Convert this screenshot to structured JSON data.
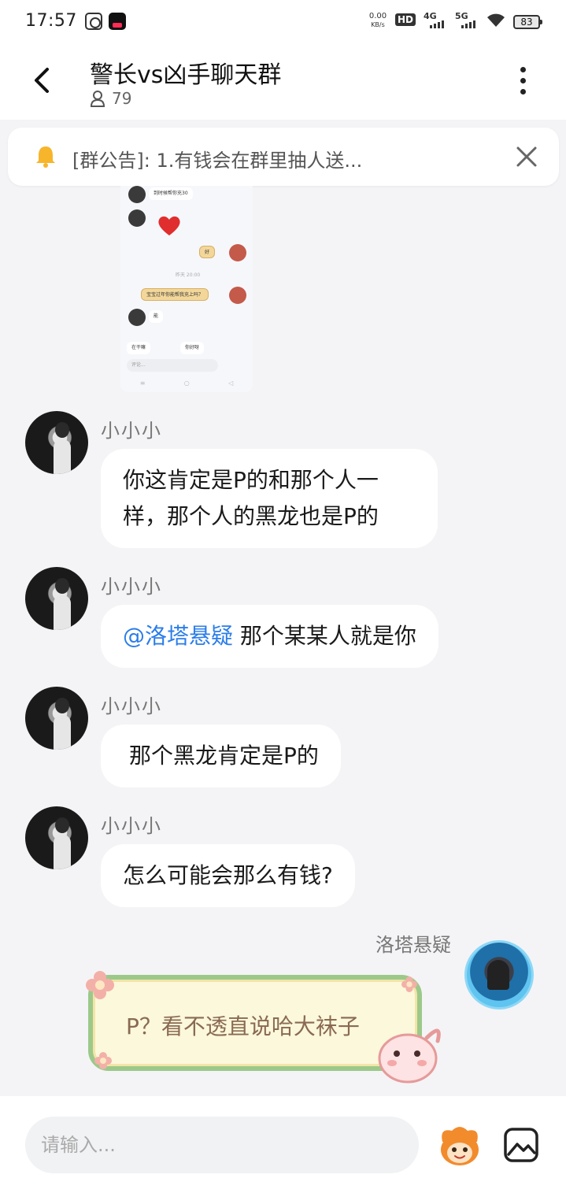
{
  "status_bar": {
    "time": "17:57",
    "net_speed_value": "0.00",
    "net_speed_unit": "KB/s",
    "hd_label": "HD",
    "net_4g": "4G",
    "net_5g": "5G",
    "battery": "83",
    "icons": [
      "scissors-app-icon",
      "video-app-icon",
      "wifi-icon",
      "battery-icon"
    ]
  },
  "header": {
    "title": "警长vs凶手聊天群",
    "member_count": "79",
    "icons": [
      "back-arrow-icon",
      "person-icon",
      "more-vertical-icon"
    ]
  },
  "announcement": {
    "text": "[群公告]: 1.有钱会在群里抽人送...",
    "icons": [
      "bell-icon",
      "close-icon"
    ]
  },
  "shared_image": {
    "lines": [
      "到时候帮你充30",
      "好",
      "昨天 20:00",
      "宝宝过年你能帮我充上吗？",
      "能",
      "在干嘛",
      "你好呀",
      "评论..."
    ],
    "nav": [
      "≡",
      "○",
      "◁"
    ]
  },
  "messages": [
    {
      "sender": "小小小",
      "text": "你这肯定是P的和那个人一样，那个人的黑龙也是P的"
    },
    {
      "sender": "小小小",
      "mention": "@洛塔悬疑",
      "text": " 那个某某人就是你"
    },
    {
      "sender": "小小小",
      "text": "那个黑龙肯定是P的"
    },
    {
      "sender": "小小小",
      "text": "怎么可能会那么有钱?"
    }
  ],
  "my_message": {
    "sender": "洛塔悬疑",
    "text": "P？看不透直说哈大袜子"
  },
  "input_bar": {
    "placeholder": "请输入...",
    "icons": [
      "emoji-mascot-icon",
      "image-icon"
    ]
  },
  "colors": {
    "mention": "#2b7de9",
    "bell": "#f7b52c",
    "bubble_border": "#9cc98a",
    "bubble_fill": "#fbf8dc",
    "page_bg": "#f4f4f6"
  }
}
